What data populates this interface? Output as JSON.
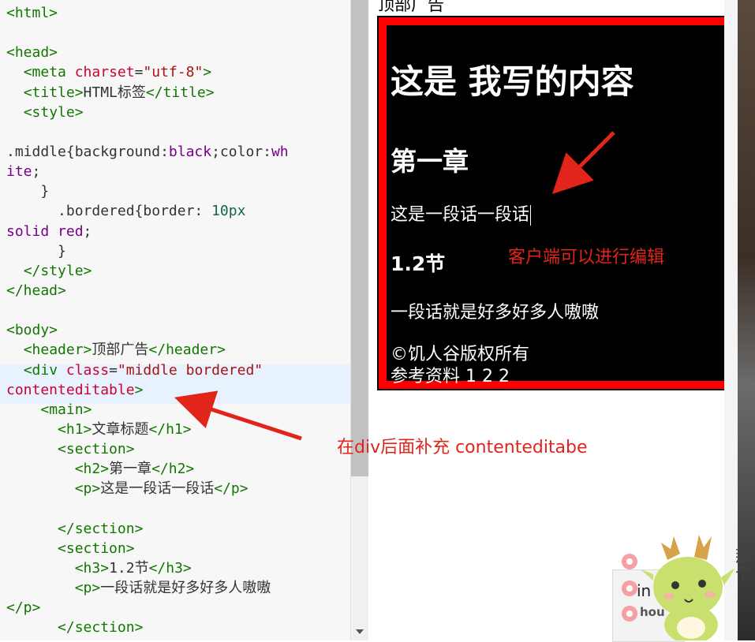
{
  "editor": {
    "lines": [
      [
        [
          "tg",
          "<html>"
        ]
      ],
      [],
      [
        [
          "tg",
          "<head>"
        ]
      ],
      [
        [
          "pl",
          "  "
        ],
        [
          "tg",
          "<meta "
        ],
        [
          "atn",
          "charset"
        ],
        [
          "pl",
          "="
        ],
        [
          "av",
          "\"utf-8\""
        ],
        [
          "tg",
          ">"
        ]
      ],
      [
        [
          "pl",
          "  "
        ],
        [
          "tg",
          "<title>"
        ],
        [
          "pl",
          "HTML标签"
        ],
        [
          "tg",
          "</title>"
        ]
      ],
      [
        [
          "pl",
          "  "
        ],
        [
          "tg",
          "<style>"
        ]
      ],
      [],
      [
        [
          "pl",
          ".middle{background:"
        ],
        [
          "kw",
          "black"
        ],
        [
          "pl",
          ";color:"
        ],
        [
          "kw",
          "wh"
        ]
      ],
      [
        [
          "kw",
          "ite"
        ],
        [
          "pl",
          ";"
        ]
      ],
      [
        [
          "pl",
          "    }"
        ]
      ],
      [
        [
          "pl",
          "      .bordered{border: "
        ],
        [
          "num",
          "10px"
        ]
      ],
      [
        [
          "kw",
          "solid"
        ],
        [
          "pl",
          " "
        ],
        [
          "kw",
          "red"
        ],
        [
          "pl",
          ";"
        ]
      ],
      [
        [
          "pl",
          "      }"
        ]
      ],
      [
        [
          "pl",
          "  "
        ],
        [
          "tg",
          "</style>"
        ]
      ],
      [
        [
          "tg",
          "</head>"
        ]
      ],
      [],
      [
        [
          "tg",
          "<body>"
        ]
      ],
      [
        [
          "pl",
          "  "
        ],
        [
          "tg",
          "<header>"
        ],
        [
          "pl",
          "顶部广告"
        ],
        [
          "tg",
          "</header>"
        ]
      ],
      [
        [
          "pl",
          "  "
        ],
        [
          "tg",
          "<div "
        ],
        [
          "atn",
          "class"
        ],
        [
          "pl",
          "="
        ],
        [
          "av",
          "\"middle bordered\""
        ]
      ],
      [
        [
          "atn",
          "contenteditable"
        ],
        [
          "tg",
          ">"
        ]
      ],
      [
        [
          "pl",
          "    "
        ],
        [
          "tg",
          "<main>"
        ]
      ],
      [
        [
          "pl",
          "      "
        ],
        [
          "tg",
          "<h1>"
        ],
        [
          "pl",
          "文章标题"
        ],
        [
          "tg",
          "</h1>"
        ]
      ],
      [
        [
          "pl",
          "      "
        ],
        [
          "tg",
          "<section>"
        ]
      ],
      [
        [
          "pl",
          "        "
        ],
        [
          "tg",
          "<h2>"
        ],
        [
          "pl",
          "第一章"
        ],
        [
          "tg",
          "</h2>"
        ]
      ],
      [
        [
          "pl",
          "        "
        ],
        [
          "tg",
          "<p>"
        ],
        [
          "pl",
          "这是一段话一段话"
        ],
        [
          "tg",
          "</p>"
        ]
      ],
      [],
      [
        [
          "pl",
          "      "
        ],
        [
          "tg",
          "</section>"
        ]
      ],
      [
        [
          "pl",
          "      "
        ],
        [
          "tg",
          "<section>"
        ]
      ],
      [
        [
          "pl",
          "        "
        ],
        [
          "tg",
          "<h3>"
        ],
        [
          "pl",
          "1.2节"
        ],
        [
          "tg",
          "</h3>"
        ]
      ],
      [
        [
          "pl",
          "        "
        ],
        [
          "tg",
          "<p>"
        ],
        [
          "pl",
          "一段话就是好多好多人嗷嗷"
        ]
      ],
      [
        [
          "tg",
          "</p>"
        ]
      ],
      [
        [
          "pl",
          "      "
        ],
        [
          "tg",
          "</section>"
        ]
      ]
    ]
  },
  "preview": {
    "header": "顶部广告",
    "h1": "这是 我写的内容",
    "h2": "第一章",
    "p1": "这是一段话一段话",
    "h3": "1.2节",
    "p2": "一段话就是好多好多人嗷嗷",
    "copyright": "©饥人谷版权所有",
    "refs": "参考资料 1 2 2"
  },
  "annotations": {
    "client_edit": "客户端可以进行编辑",
    "add_attr": "在div后面补充 contenteditabe"
  },
  "sticker": {
    "side_text": "那个...",
    "card_top": "in",
    "card_bottom": "hou"
  },
  "colors": {
    "annotation_red": "#e1251b",
    "border_red": "#ff0000"
  }
}
